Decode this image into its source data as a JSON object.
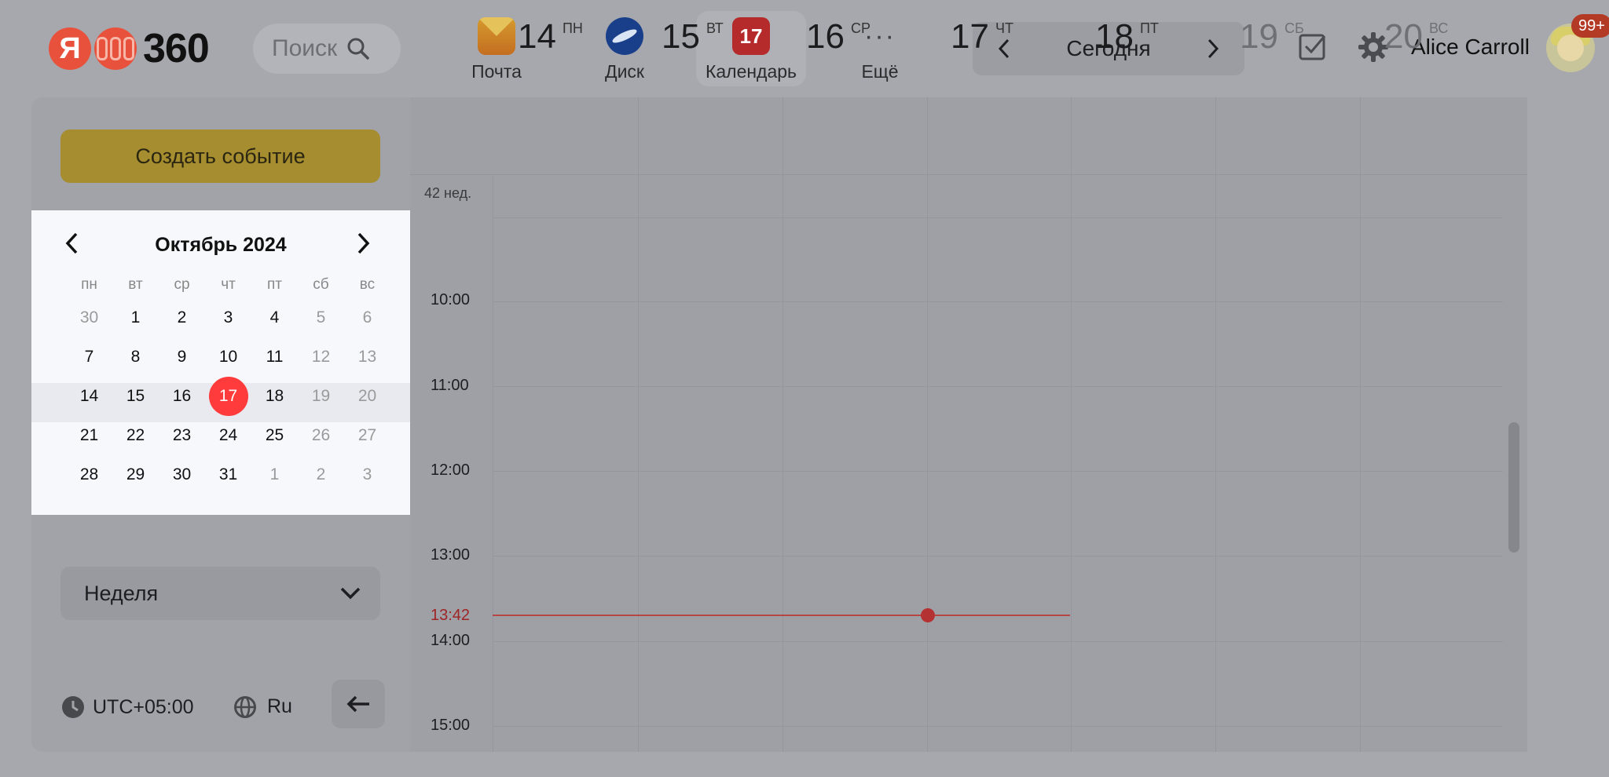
{
  "header": {
    "logo_text": "360",
    "logo_letter": "Я",
    "search_placeholder": "Поиск",
    "apps": [
      {
        "label": "Почта",
        "icon": "mail-icon"
      },
      {
        "label": "Диск",
        "icon": "disk-icon"
      },
      {
        "label": "Календарь",
        "icon": "calendar-icon",
        "badge": "17"
      },
      {
        "label": "Ещё",
        "icon": "more-icon",
        "glyph": "···"
      }
    ],
    "today_label": "Сегодня",
    "user_name": "Alice Carroll",
    "notifications": "99+"
  },
  "sidebar": {
    "create_label": "Создать событие",
    "mini_calendar": {
      "month_title": "Октябрь 2024",
      "weekdays": [
        "пн",
        "вт",
        "ср",
        "чт",
        "пт",
        "сб",
        "вс"
      ],
      "weeks": [
        [
          "30",
          "1",
          "2",
          "3",
          "4",
          "5",
          "6"
        ],
        [
          "7",
          "8",
          "9",
          "10",
          "11",
          "12",
          "13"
        ],
        [
          "14",
          "15",
          "16",
          "17",
          "18",
          "19",
          "20"
        ],
        [
          "21",
          "22",
          "23",
          "24",
          "25",
          "26",
          "27"
        ],
        [
          "28",
          "29",
          "30",
          "31",
          "1",
          "2",
          "3"
        ]
      ],
      "today": "17"
    },
    "view_label": "Неделя",
    "timezone": "UTC+05:00",
    "language": "Ru"
  },
  "week": {
    "week_number": "42 нед.",
    "days": [
      {
        "num": "14",
        "wd": "ПН"
      },
      {
        "num": "15",
        "wd": "ВТ"
      },
      {
        "num": "16",
        "wd": "СР"
      },
      {
        "num": "17",
        "wd": "ЧТ"
      },
      {
        "num": "18",
        "wd": "ПТ"
      },
      {
        "num": "19",
        "wd": "СБ"
      },
      {
        "num": "20",
        "wd": "ВС"
      }
    ],
    "hours": [
      "10:00",
      "11:00",
      "12:00",
      "13:00",
      "14:00",
      "15:00"
    ],
    "now_time": "13:42"
  },
  "colors": {
    "accent": "#ff3b3b",
    "create_button": "#a68d2f",
    "overlay_bg": "#a7a8ad"
  }
}
